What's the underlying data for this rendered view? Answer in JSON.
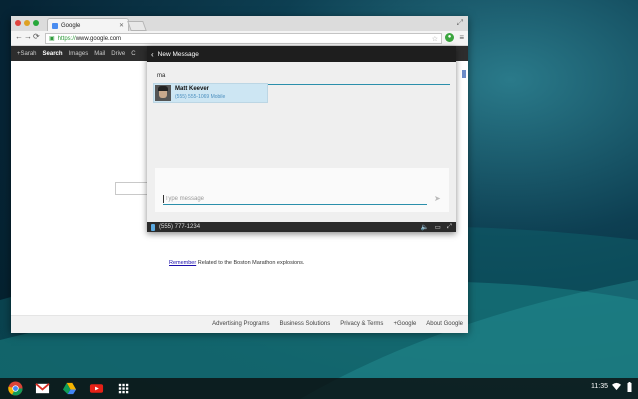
{
  "browser": {
    "tab_title": "Google",
    "url_scheme": "https://",
    "url_host": "www.google.com"
  },
  "google_bar": {
    "items": [
      "+Sarah",
      "Search",
      "Images",
      "Mail",
      "Drive",
      "C"
    ]
  },
  "page": {
    "news_link": "Remember",
    "news_text": " Related to the Boston Marathon explosions.",
    "footer_links": [
      "Advertising Programs",
      "Business Solutions",
      "Privacy & Terms",
      "+Google",
      "About Google"
    ]
  },
  "messaging": {
    "header_title": "New Message",
    "recipient_query": "ma",
    "suggestion": {
      "name": "Matt Keever",
      "number": "(555) 555-1069 Mobile"
    },
    "message_placeholder": "Type message",
    "phone_number": "(555) 777-1234"
  },
  "shelf": {
    "time": "11:35"
  },
  "colors": {
    "accent": "#2b8fab",
    "header": "#1e1e1e",
    "suggestion_bg": "#cde6f3"
  }
}
